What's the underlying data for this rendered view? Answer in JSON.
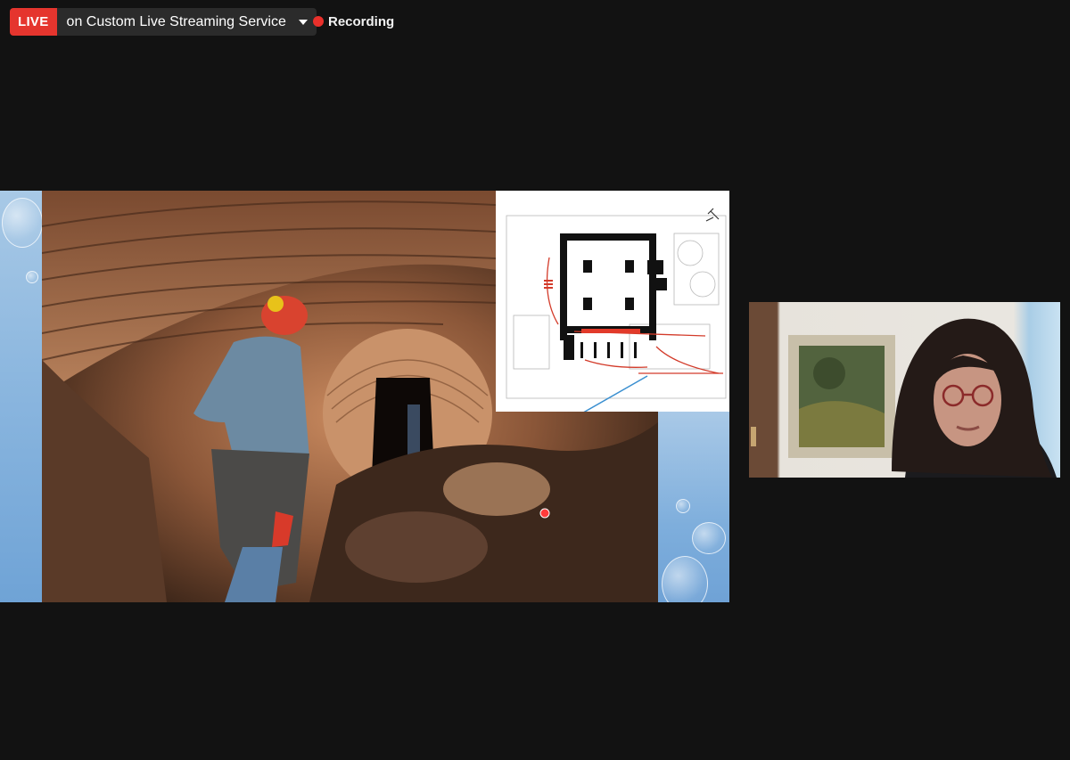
{
  "top_bar": {
    "live_label": "LIVE",
    "stream_service": "on Custom Live Streaming Service",
    "recording_label": "Recording"
  },
  "colors": {
    "live_red": "#e5352e",
    "recording_red": "#e9302b",
    "background": "#121212"
  },
  "icons": [
    "chevron-down-icon",
    "recording-dot-icon"
  ]
}
